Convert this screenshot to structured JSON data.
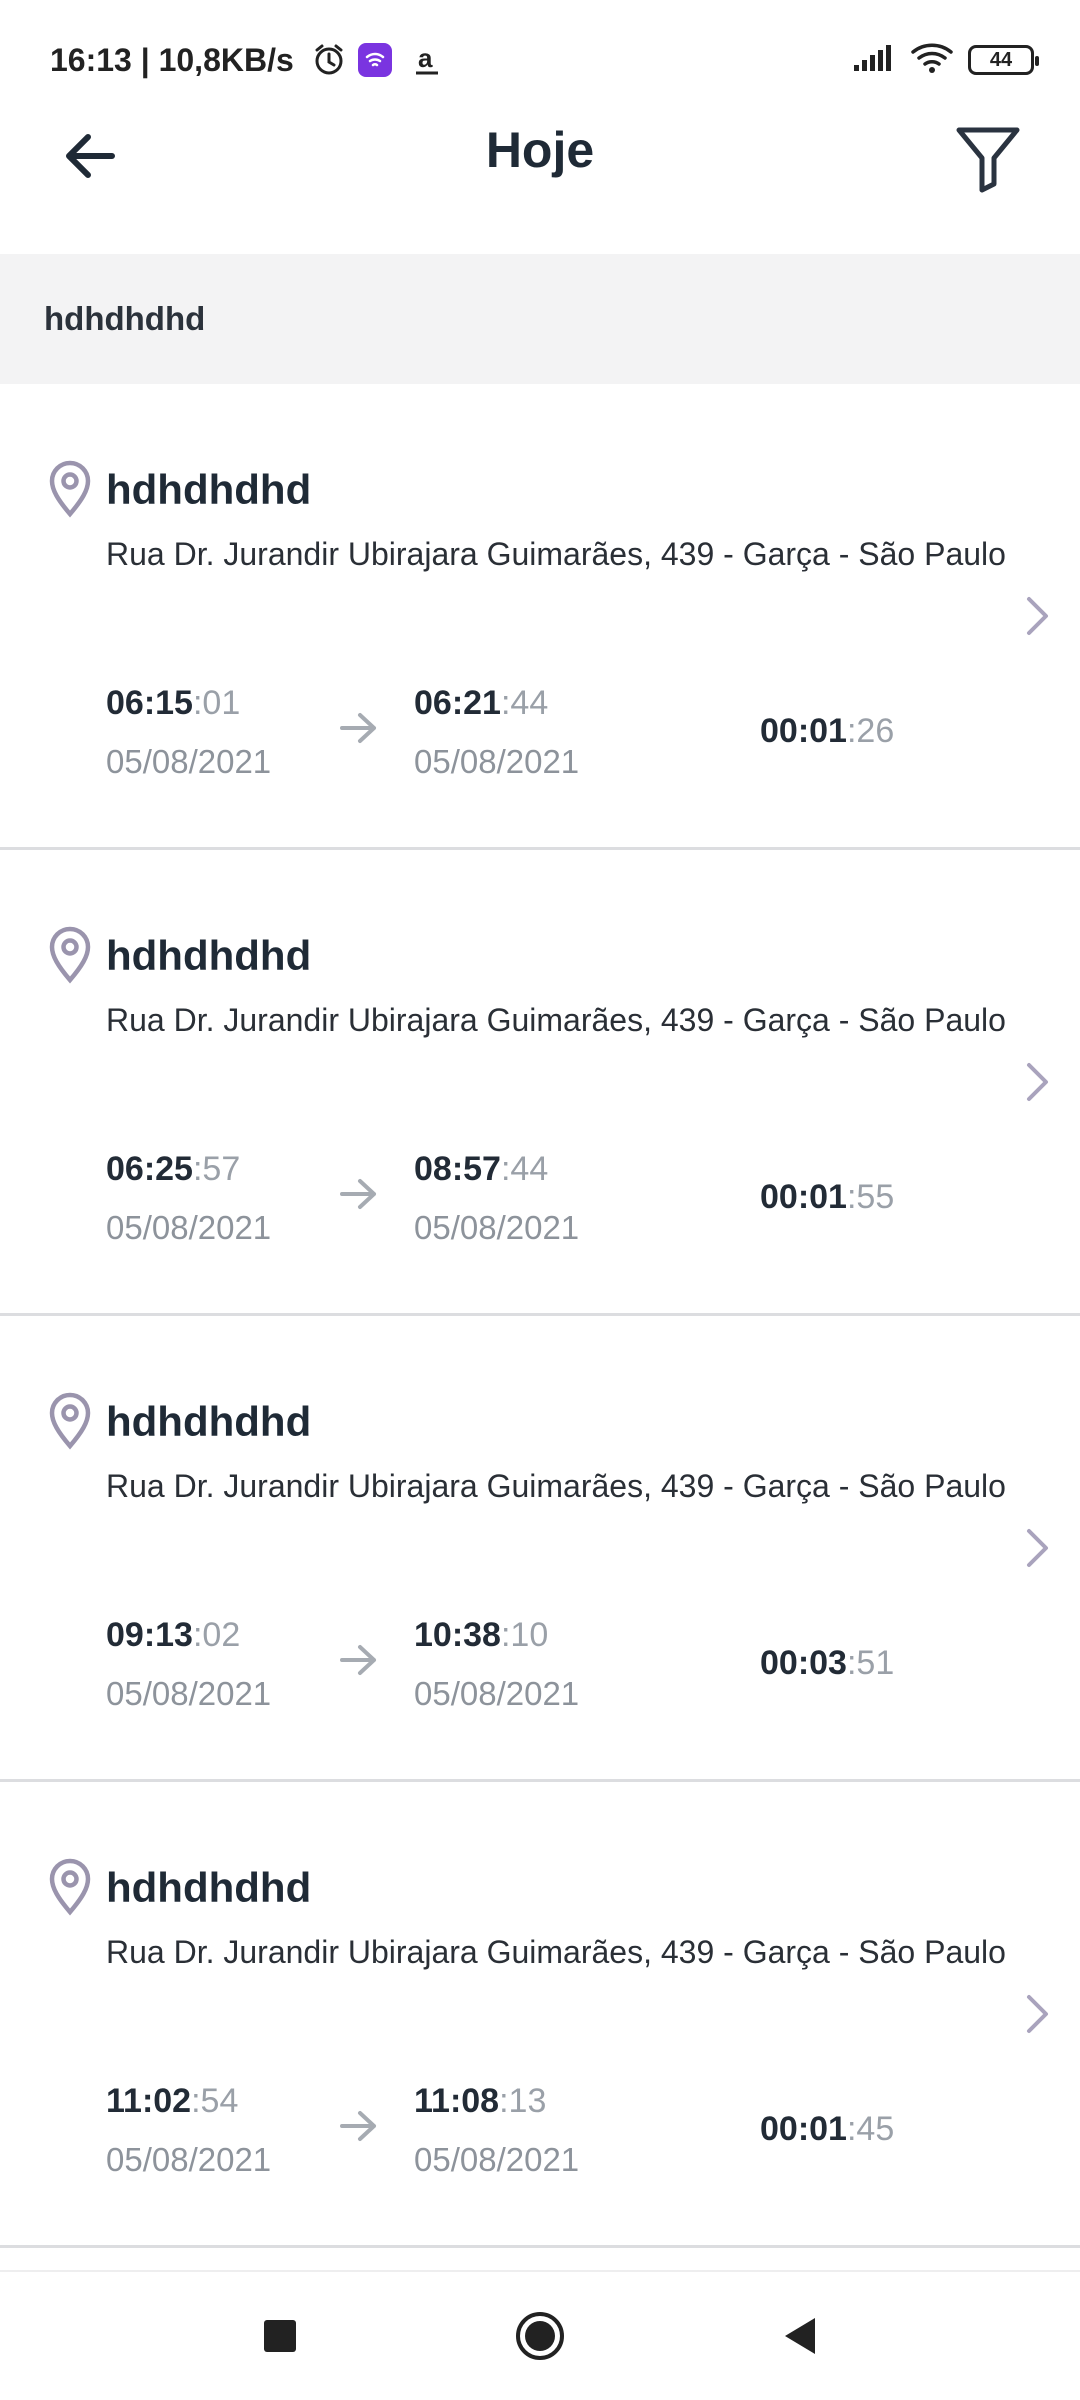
{
  "status_bar": {
    "time_speed": "16:13 | 10,8KB/s",
    "battery": "44",
    "icons": [
      "alarm-icon",
      "app-badge-icon",
      "amazon-icon",
      "signal-icon",
      "wifi-icon",
      "battery-icon"
    ]
  },
  "header": {
    "title": "Hoje",
    "back_icon": "arrow-left-icon",
    "filter_icon": "filter-funnel-icon"
  },
  "filter_strip": {
    "text": "hdhdhdhd"
  },
  "records": [
    {
      "title": "hdhdhdhd",
      "address": "Rua Dr. Jurandir Ubirajara Guimarães, 439 - Garça - São Paulo",
      "start_hm": "06:15",
      "start_s": ":01",
      "start_date": "05/08/2021",
      "end_hm": "06:21",
      "end_s": ":44",
      "end_date": "05/08/2021",
      "dur_hm": "00:01",
      "dur_s": ":26"
    },
    {
      "title": "hdhdhdhd",
      "address": "Rua Dr. Jurandir Ubirajara Guimarães, 439 - Garça - São Paulo",
      "start_hm": "06:25",
      "start_s": ":57",
      "start_date": "05/08/2021",
      "end_hm": "08:57",
      "end_s": ":44",
      "end_date": "05/08/2021",
      "dur_hm": "00:01",
      "dur_s": ":55"
    },
    {
      "title": "hdhdhdhd",
      "address": "Rua Dr. Jurandir Ubirajara Guimarães, 439 - Garça - São Paulo",
      "start_hm": "09:13",
      "start_s": ":02",
      "start_date": "05/08/2021",
      "end_hm": "10:38",
      "end_s": ":10",
      "end_date": "05/08/2021",
      "dur_hm": "00:03",
      "dur_s": ":51"
    },
    {
      "title": "hdhdhdhd",
      "address": "Rua Dr. Jurandir Ubirajara Guimarães, 439 - Garça - São Paulo",
      "start_hm": "11:02",
      "start_s": ":54",
      "start_date": "05/08/2021",
      "end_hm": "11:08",
      "end_s": ":13",
      "end_date": "05/08/2021",
      "dur_hm": "00:01",
      "dur_s": ":45"
    }
  ],
  "nav": {
    "icons": [
      "recents-square-icon",
      "home-circle-icon",
      "back-triangle-icon"
    ]
  },
  "colors": {
    "accent_icon": "#9a94ad",
    "text_dark": "#1f2a36",
    "muted": "#8d939b",
    "divider": "#dcdde0",
    "strip_bg": "#f3f3f4"
  }
}
